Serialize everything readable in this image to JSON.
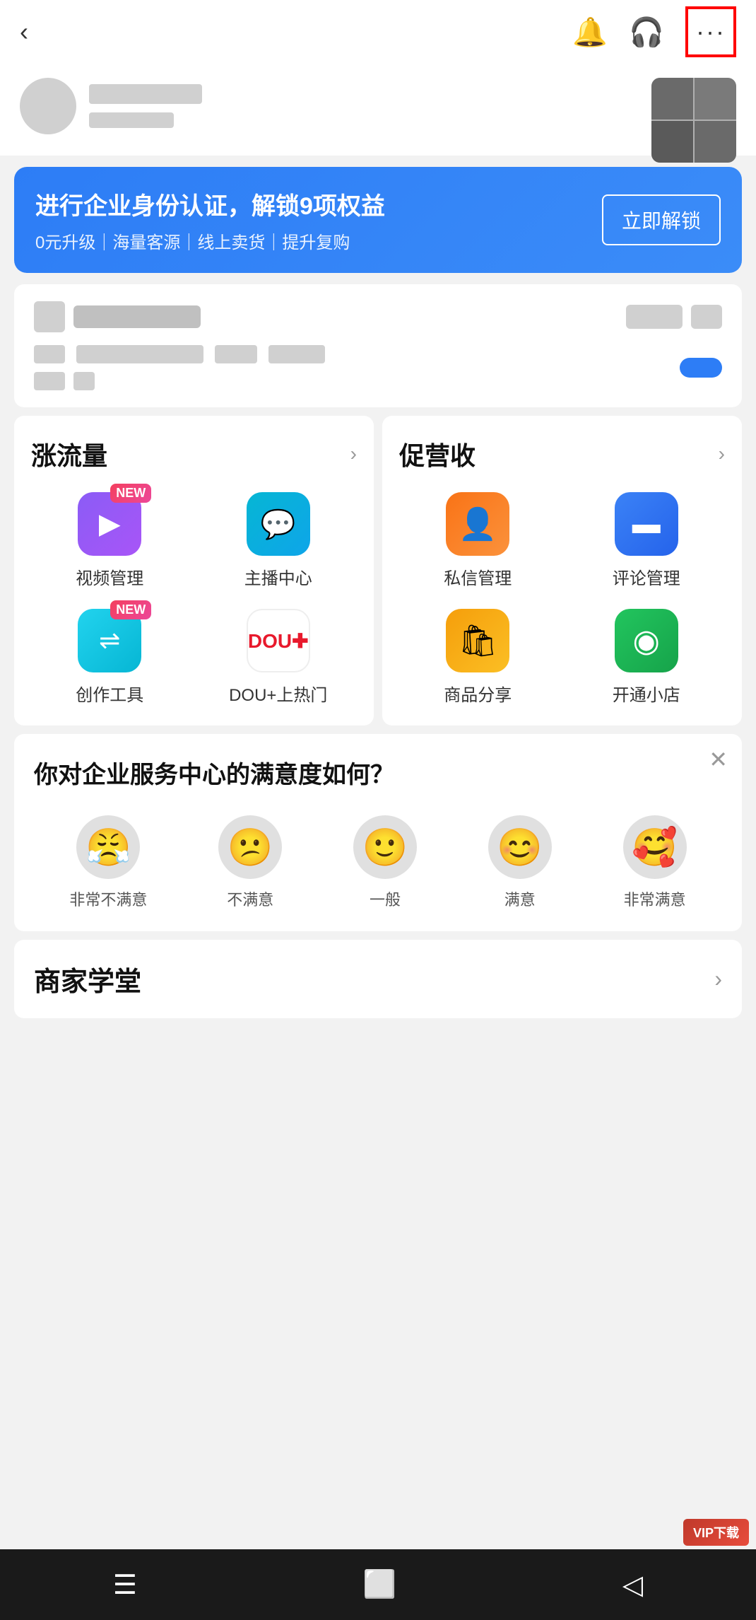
{
  "topbar": {
    "back_label": "‹",
    "bell_icon": "🔔",
    "headset_icon": "🎧",
    "more_icon": "···"
  },
  "promo": {
    "title": "进行企业身份认证，解锁9项权益",
    "subtitle": "0元升级｜海量客源｜线上卖货｜提升复购",
    "button": "立即解锁"
  },
  "features": {
    "section1": {
      "title": "涨流量",
      "items": [
        {
          "label": "视频管理",
          "icon": "▶",
          "color": "purple",
          "new": true
        },
        {
          "label": "主播中心",
          "icon": "💬",
          "color": "teal",
          "new": false
        },
        {
          "label": "创作工具",
          "icon": "↔",
          "color": "cyan",
          "new": true
        },
        {
          "label": "DOU+上热门",
          "icon": "DOU+",
          "color": "dou",
          "new": false
        }
      ]
    },
    "section2": {
      "title": "促营收",
      "items": [
        {
          "label": "私信管理",
          "icon": "👤",
          "color": "orange",
          "new": false
        },
        {
          "label": "评论管理",
          "icon": "💬",
          "color": "blue-flat",
          "new": false
        },
        {
          "label": "商品分享",
          "icon": "🛍",
          "color": "yellow",
          "new": false
        },
        {
          "label": "开通小店",
          "icon": "◉",
          "color": "green",
          "new": false
        }
      ]
    }
  },
  "satisfaction": {
    "title": "你对企业服务中心的满意度如何？",
    "options": [
      {
        "emoji": "😤",
        "label": "非常不满意"
      },
      {
        "emoji": "😕",
        "label": "不满意"
      },
      {
        "emoji": "🙂",
        "label": "一般"
      },
      {
        "emoji": "😊",
        "label": "满意"
      },
      {
        "emoji": "🥰",
        "label": "非常满意"
      }
    ]
  },
  "merchant_school": {
    "title": "商家学堂"
  },
  "bottom_nav": {
    "menu_icon": "☰",
    "home_icon": "⬜",
    "back_icon": "◁"
  },
  "vip": {
    "label": "VIP下载"
  }
}
